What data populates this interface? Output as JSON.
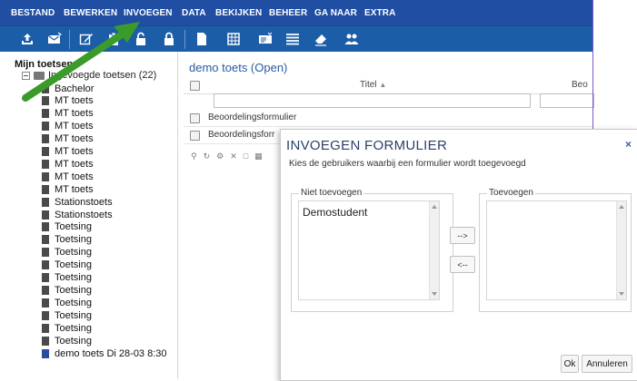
{
  "menu": {
    "items": [
      "BESTAND",
      "BEWERKEN",
      "INVOEGEN",
      "DATA",
      "BEKIJKEN",
      "BEHEER",
      "GA NAAR",
      "EXTRA"
    ]
  },
  "toolbar": {
    "icons": [
      "upload-tray-icon",
      "mail-icon",
      "edit-icon",
      "paste-icon",
      "lock-open-icon",
      "lock-icon",
      "document-icon",
      "table-icon",
      "id-card-icon",
      "list-icon",
      "eraser-icon",
      "users-icon"
    ]
  },
  "tree": {
    "title": "Mijn toetsen",
    "root": "Ingevoegde toetsen (22)",
    "items": [
      "Bachelor",
      "MT toets",
      "MT toets",
      "MT toets",
      "MT toets",
      "MT toets",
      "MT toets",
      "MT toets",
      "MT toets",
      "Stationstoets",
      "Stationstoets",
      "Toetsing",
      "Toetsing",
      "Toetsing",
      "Toetsing",
      "Toetsing",
      "Toetsing",
      "Toetsing",
      "Toetsing",
      "Toetsing",
      "Toetsing"
    ],
    "selected": "demo toets Di 28-03 8:30"
  },
  "center": {
    "title": "demo toets (Open)",
    "columns": [
      "Titel",
      "Beo"
    ],
    "rows": [
      "Beoordelingsformulier",
      "Beoordelingsforr"
    ]
  },
  "dialog": {
    "title": "INVOEGEN FORMULIER",
    "close": "×",
    "subtitle": "Kies de gebruikers waarbij een formulier wordt toegevoegd",
    "left_legend": "Niet toevoegen",
    "right_legend": "Toevoegen",
    "left_items": [
      "Demostudent"
    ],
    "right_items": [],
    "add_button": "-->",
    "remove_button": "<--",
    "ok_button": "Ok",
    "cancel_button": "Annuleren"
  },
  "colors": {
    "menubar": "#1f4ea3",
    "toolbar": "#1c5da8",
    "accent_title": "#2a5aa6",
    "arrow": "#3a9a2a"
  }
}
